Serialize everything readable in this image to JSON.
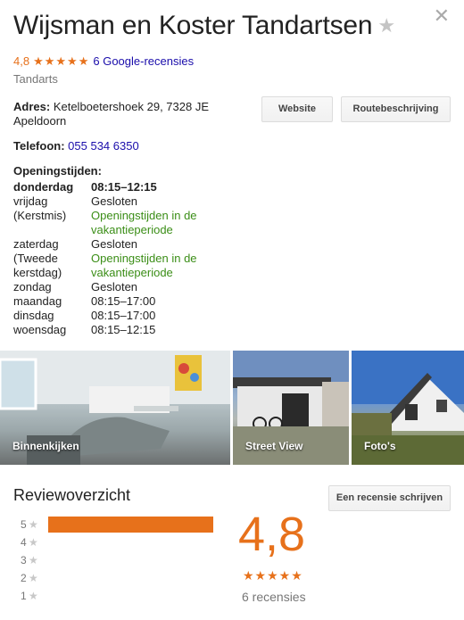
{
  "header": {
    "title": "Wijsman en Koster Tandartsen",
    "save_icon": "star-icon",
    "close_icon": "close-icon"
  },
  "rating": {
    "score": "4,8",
    "stars": "★★★★★",
    "review_link": "6 Google-recensies"
  },
  "category": "Tandarts",
  "address": {
    "label": "Adres:",
    "value": "Ketelboetershoek 29, 7328 JE Apeldoorn"
  },
  "phone": {
    "label": "Telefoon:",
    "value": "055 534 6350"
  },
  "buttons": {
    "website": "Website",
    "route": "Routebeschrijving",
    "write_review": "Een recensie schrijven"
  },
  "hours": {
    "label": "Openingstijden:",
    "rows": [
      {
        "day": "donderdag",
        "time": "08:15–12:15",
        "today": true
      },
      {
        "day": "vrijdag",
        "time": "Gesloten"
      },
      {
        "day": "(Kerstmis)",
        "time": "Openingstijden in de vakantieperiode",
        "green": true
      },
      {
        "day": "zaterdag",
        "time": "Gesloten"
      },
      {
        "day": "(Tweede kerstdag)",
        "time": "Openingstijden in de vakantieperiode",
        "green": true
      },
      {
        "day": "zondag",
        "time": "Gesloten"
      },
      {
        "day": "maandag",
        "time": "08:15–17:00"
      },
      {
        "day": "dinsdag",
        "time": "08:15–17:00"
      },
      {
        "day": "woensdag",
        "time": "08:15–12:15"
      }
    ]
  },
  "photos": [
    {
      "label": "Binnenkijken"
    },
    {
      "label": "Street View"
    },
    {
      "label": "Foto's"
    }
  ],
  "reviews": {
    "title": "Reviewoverzicht",
    "big_score": "4,8",
    "big_stars": "★★★★★",
    "count": "6 recensies",
    "distribution": [
      {
        "stars": "5",
        "fraction": 1.0
      },
      {
        "stars": "4",
        "fraction": 0
      },
      {
        "stars": "3",
        "fraction": 0
      },
      {
        "stars": "2",
        "fraction": 0
      },
      {
        "stars": "1",
        "fraction": 0
      }
    ]
  },
  "colors": {
    "accent_orange": "#e7711b",
    "link_blue": "#1a0dab",
    "green": "#3b8e17"
  }
}
